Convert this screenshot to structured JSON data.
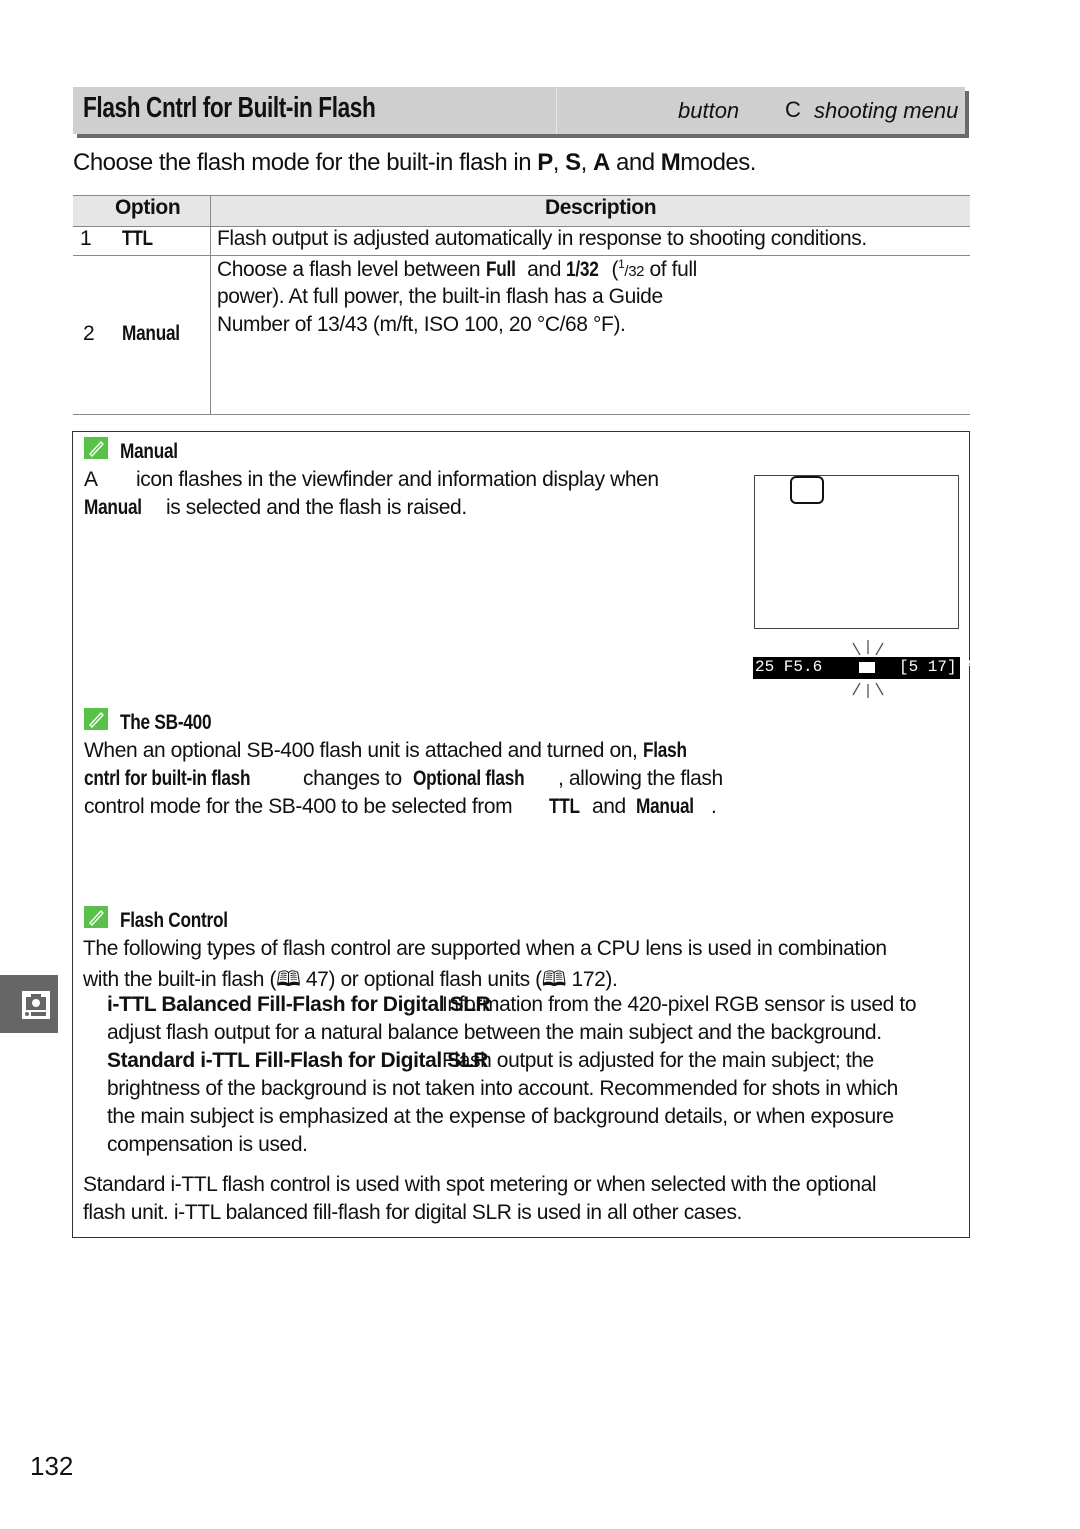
{
  "header": {
    "title": "Flash Cntrl for Built-in Flash",
    "button_label": "button",
    "menu_glyph": "C",
    "menu_label": "shooting menu"
  },
  "intro": {
    "text_before": "Choose the flash mode for the built-in flash in ",
    "modes": [
      "P",
      "S",
      "A"
    ],
    "and": " and ",
    "mode_m": "M",
    "text_after": "modes."
  },
  "table": {
    "headers": [
      "Option",
      "Description"
    ],
    "rows": [
      {
        "num": "1",
        "option": "TTL",
        "description": "Flash output is adjusted automatically in response to shooting conditions."
      },
      {
        "num": "2",
        "option": "Manual",
        "line1_a": "Choose a flash level between ",
        "full": "Full",
        "line1_b": " and ",
        "frac": "1/32",
        "line1_c": " (",
        "sup": "1",
        "sub": "/32",
        "line1_d": " of full",
        "line2": "power).  At full power, the built-in flash has a Guide",
        "line3": "Number of 13/43 (m/ft, ISO 100, 20 °C/68 °F)."
      }
    ]
  },
  "notes": {
    "manual": {
      "title": "Manual",
      "line1_a": "A",
      "line1_b": "icon flashes in the viewfinder and information display when",
      "line2_bold": "Manual",
      "line2_text": "is selected and the flash is raised.",
      "display": {
        "left": "25  F5.6",
        "right": "[5 17] ϟ"
      }
    },
    "sb400": {
      "title": "The SB-400",
      "line1": "When an optional SB-400 flash unit is attached and turned on, ",
      "line1_bold": "Flash",
      "line2_bold": "cntrl for built-in flash",
      "line2_mid": "changes to ",
      "line2_bold2": "Optional flash",
      "line2_end": ", allowing the flash",
      "line3": "control mode for the SB-400 to be selected from ",
      "ttl": "TTL",
      "and": "and ",
      "manual": "Manual",
      "period": "."
    },
    "flash_control": {
      "title": "Flash Control",
      "line1": "The following types of flash control are supported when a CPU lens is used in combination",
      "line2": "with the built-in flash (🕮 47) or optional flash units (🕮 172).",
      "items": [
        {
          "term": "i-TTL Balanced Fill-Flash for Digital SLR",
          "text1": "Information from the 420-pixel RGB sensor is used to",
          "text2": "adjust flash output for a natural balance between the main subject and the background."
        },
        {
          "term": "Standard i-TTL Fill-Flash for Digital SLR",
          "text1": "Flash output is adjusted for the main subject; the",
          "text2": "brightness of the background is not taken into account.  Recommended for shots in which",
          "text3": "the main subject is emphasized at the expense of background details, or when exposure",
          "text4": "compensation is used."
        }
      ],
      "footer1": "Standard i-TTL flash control is used with spot metering or when selected with the optional",
      "footer2": "flash unit.  i-TTL balanced fill-flash for digital SLR is used in all other cases."
    }
  },
  "side_tab_icon": "camera-icon",
  "page_number": "132",
  "colors": {
    "title_bar": "#cfcfcf",
    "note_icon": "#59c14a",
    "side_tab": "#666666"
  }
}
